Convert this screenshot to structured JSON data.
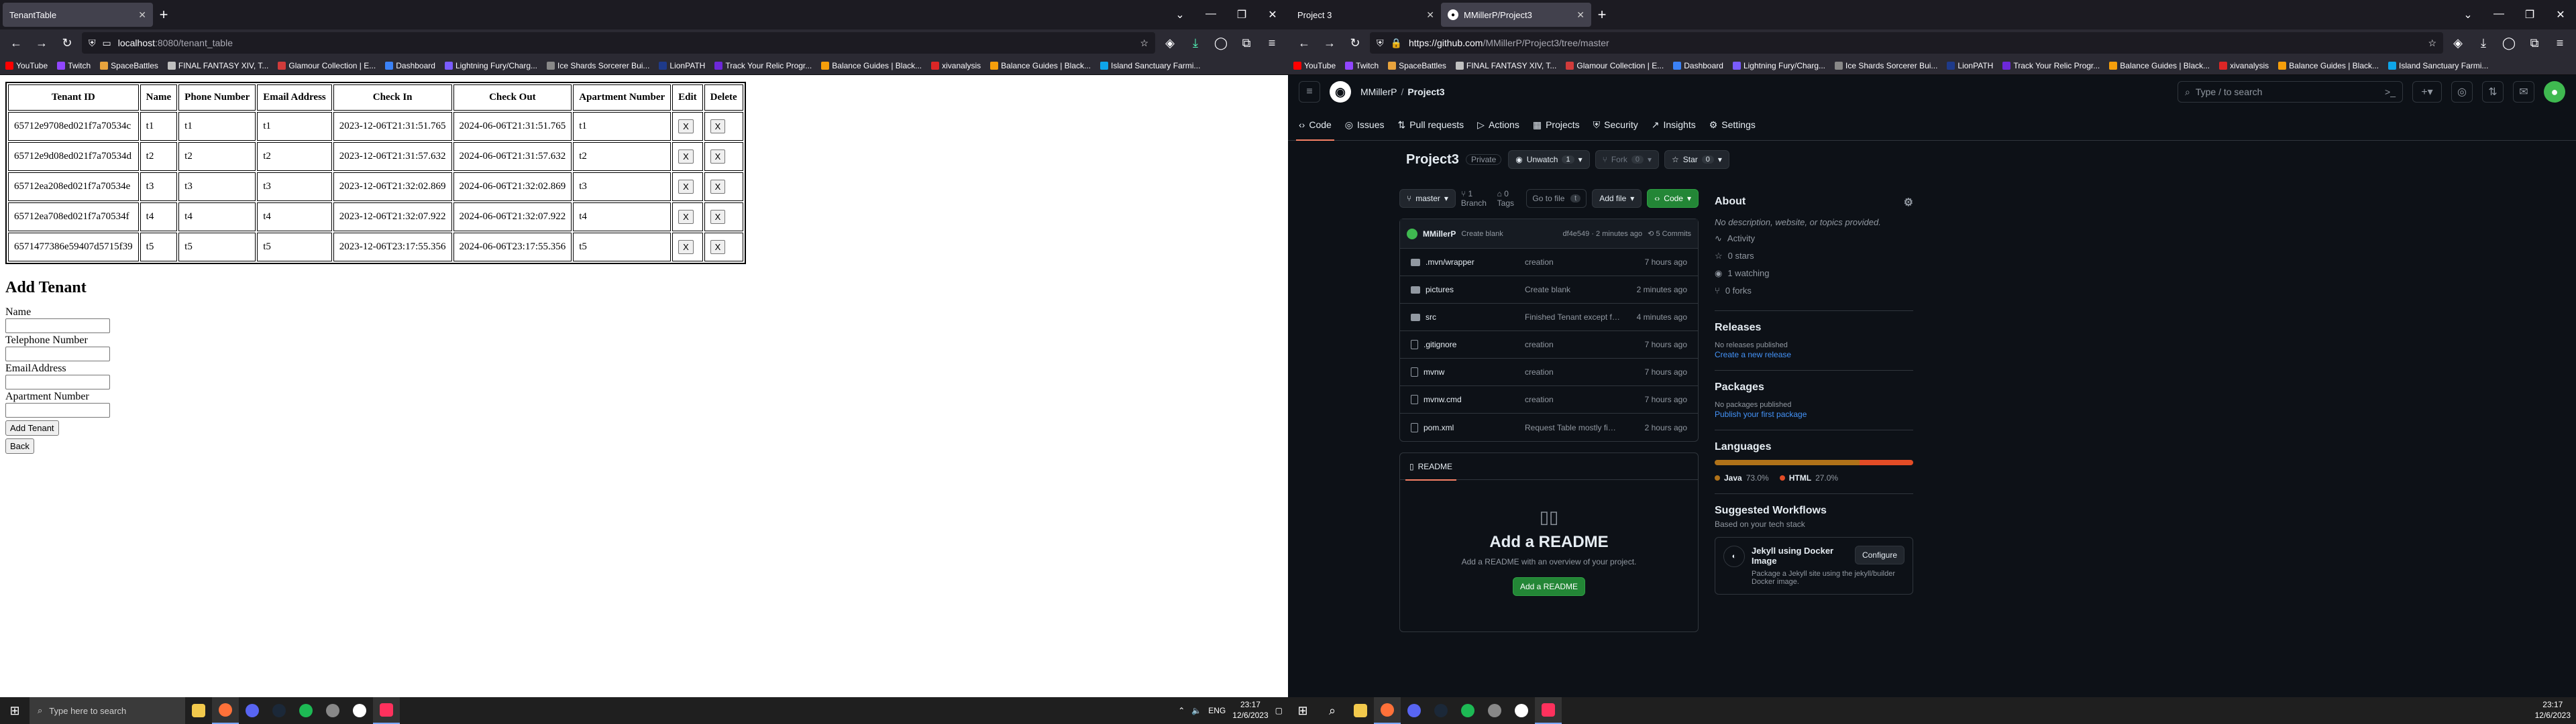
{
  "left": {
    "tabs": [
      {
        "title": "TenantTable",
        "active": true
      }
    ],
    "url": {
      "host": "localhost",
      "rest": ":8080/tenant_table"
    },
    "bookmarks": [
      {
        "label": "YouTube",
        "color": "#ff0000"
      },
      {
        "label": "Twitch",
        "color": "#9146ff"
      },
      {
        "label": "SpaceBattles",
        "color": "#e8a33d"
      },
      {
        "label": "FINAL FANTASY XIV, T...",
        "color": "#c0c0c0"
      },
      {
        "label": "Glamour Collection | E...",
        "color": "#d13b3b"
      },
      {
        "label": "Dashboard",
        "color": "#3b82f6"
      },
      {
        "label": "Lightning Fury/Charg...",
        "color": "#7a5cff"
      },
      {
        "label": "Ice Shards Sorcerer Bui...",
        "color": "#888"
      },
      {
        "label": "LionPATH",
        "color": "#1e3a8a"
      },
      {
        "label": "Track Your Relic Progr...",
        "color": "#6d28d9"
      },
      {
        "label": "Balance Guides | Black...",
        "color": "#f59e0b"
      },
      {
        "label": "xivanalysis",
        "color": "#dc2626"
      },
      {
        "label": "Balance Guides | Black...",
        "color": "#f59e0b"
      },
      {
        "label": "Island Sanctuary Farmi...",
        "color": "#0ea5e9"
      }
    ],
    "table": {
      "headers": [
        "Tenant ID",
        "Name",
        "Phone Number",
        "Email Address",
        "Check In",
        "Check Out",
        "Apartment Number",
        "Edit",
        "Delete"
      ],
      "rows": [
        [
          "65712e9708ed021f7a70534c",
          "t1",
          "t1",
          "t1",
          "2023-12-06T21:31:51.765",
          "2024-06-06T21:31:51.765",
          "t1",
          "X",
          "X"
        ],
        [
          "65712e9d08ed021f7a70534d",
          "t2",
          "t2",
          "t2",
          "2023-12-06T21:31:57.632",
          "2024-06-06T21:31:57.632",
          "t2",
          "X",
          "X"
        ],
        [
          "65712ea208ed021f7a70534e",
          "t3",
          "t3",
          "t3",
          "2023-12-06T21:32:02.869",
          "2024-06-06T21:32:02.869",
          "t3",
          "X",
          "X"
        ],
        [
          "65712ea708ed021f7a70534f",
          "t4",
          "t4",
          "t4",
          "2023-12-06T21:32:07.922",
          "2024-06-06T21:32:07.922",
          "t4",
          "X",
          "X"
        ],
        [
          "6571477386e59407d5715f39",
          "t5",
          "t5",
          "t5",
          "2023-12-06T23:17:55.356",
          "2024-06-06T23:17:55.356",
          "t5",
          "X",
          "X"
        ]
      ]
    },
    "form": {
      "title": "Add Tenant",
      "fields": [
        "Name",
        "Telephone Number",
        "EmailAddress",
        "Apartment Number"
      ],
      "submit": "Add Tenant",
      "back": "Back"
    },
    "taskbar": {
      "search_placeholder": "Type here to search",
      "lang": "ENG",
      "time": "23:17",
      "date": "12/6/2023"
    }
  },
  "right": {
    "tabs": [
      {
        "title": "Project 3",
        "active": false
      },
      {
        "title": "MMillerP/Project3",
        "active": true
      }
    ],
    "url": {
      "host": "https://github.com",
      "rest": "/MMillerP/Project3/tree/master"
    },
    "header": {
      "owner": "MMillerP",
      "repo": "Project3",
      "search_placeholder": "Type / to search",
      "nav": [
        {
          "label": "Code",
          "icon": "code-icon",
          "active": true
        },
        {
          "label": "Issues",
          "icon": "issue-icon"
        },
        {
          "label": "Pull requests",
          "icon": "pull-request-icon"
        },
        {
          "label": "Actions",
          "icon": "play-icon"
        },
        {
          "label": "Projects",
          "icon": "table-icon"
        },
        {
          "label": "Security",
          "icon": "shield-icon"
        },
        {
          "label": "Insights",
          "icon": "graph-icon"
        },
        {
          "label": "Settings",
          "icon": "gear-icon"
        }
      ]
    },
    "repo": {
      "name": "Project3",
      "visibility": "Private",
      "unwatch": "Unwatch",
      "unwatch_count": "1",
      "fork": "Fork",
      "fork_count": "0",
      "star": "Star",
      "star_count": "0",
      "branch": "master",
      "branches": "1 Branch",
      "tags": "0 Tags",
      "goto_placeholder": "Go to file",
      "goto_key": "t",
      "add_file": "Add file",
      "code_btn": "Code"
    },
    "commit": {
      "author": "MMillerP",
      "message": "Create blank",
      "hash_time": "df4e549 · 2 minutes ago",
      "commits": "5 Commits"
    },
    "files": [
      {
        "name": ".mvn/wrapper",
        "type": "folder",
        "message": "creation",
        "time": "7 hours ago"
      },
      {
        "name": "pictures",
        "type": "folder",
        "message": "Create blank",
        "time": "2 minutes ago"
      },
      {
        "name": "src",
        "type": "folder",
        "message": "Finished Tenant except for update Apartment - will not conn...",
        "time": "4 minutes ago"
      },
      {
        "name": ".gitignore",
        "type": "file",
        "message": "creation",
        "time": "7 hours ago"
      },
      {
        "name": "mvnw",
        "type": "file",
        "message": "creation",
        "time": "7 hours ago"
      },
      {
        "name": "mvnw.cmd",
        "type": "file",
        "message": "creation",
        "time": "7 hours ago"
      },
      {
        "name": "pom.xml",
        "type": "file",
        "message": "Request Table mostly finished - needs images,status update f...",
        "time": "2 hours ago"
      }
    ],
    "readme": {
      "tab": "README",
      "title": "Add a README",
      "subtitle": "Add a README with an overview of your project.",
      "button": "Add a README"
    },
    "about": {
      "title": "About",
      "description": "No description, website, or topics provided.",
      "activity": "Activity",
      "stars": "0 stars",
      "watching": "1 watching",
      "forks": "0 forks"
    },
    "releases": {
      "title": "Releases",
      "none": "No releases published",
      "link": "Create a new release"
    },
    "packages": {
      "title": "Packages",
      "none": "No packages published",
      "link": "Publish your first package"
    },
    "languages": {
      "title": "Languages",
      "items": [
        {
          "name": "Java",
          "percent": "73.0%",
          "value": 73.0,
          "color": "#b07219"
        },
        {
          "name": "HTML",
          "percent": "27.0%",
          "value": 27.0,
          "color": "#e34c26"
        }
      ]
    },
    "workflows": {
      "title": "Suggested Workflows",
      "subtitle": "Based on your tech stack",
      "item_title": "Jekyll using Docker Image",
      "item_desc": "Package a Jekyll site using the jekyll/builder Docker image.",
      "configure": "Configure"
    },
    "taskbar": {
      "time": "23:17",
      "date": "12/6/2023"
    }
  }
}
